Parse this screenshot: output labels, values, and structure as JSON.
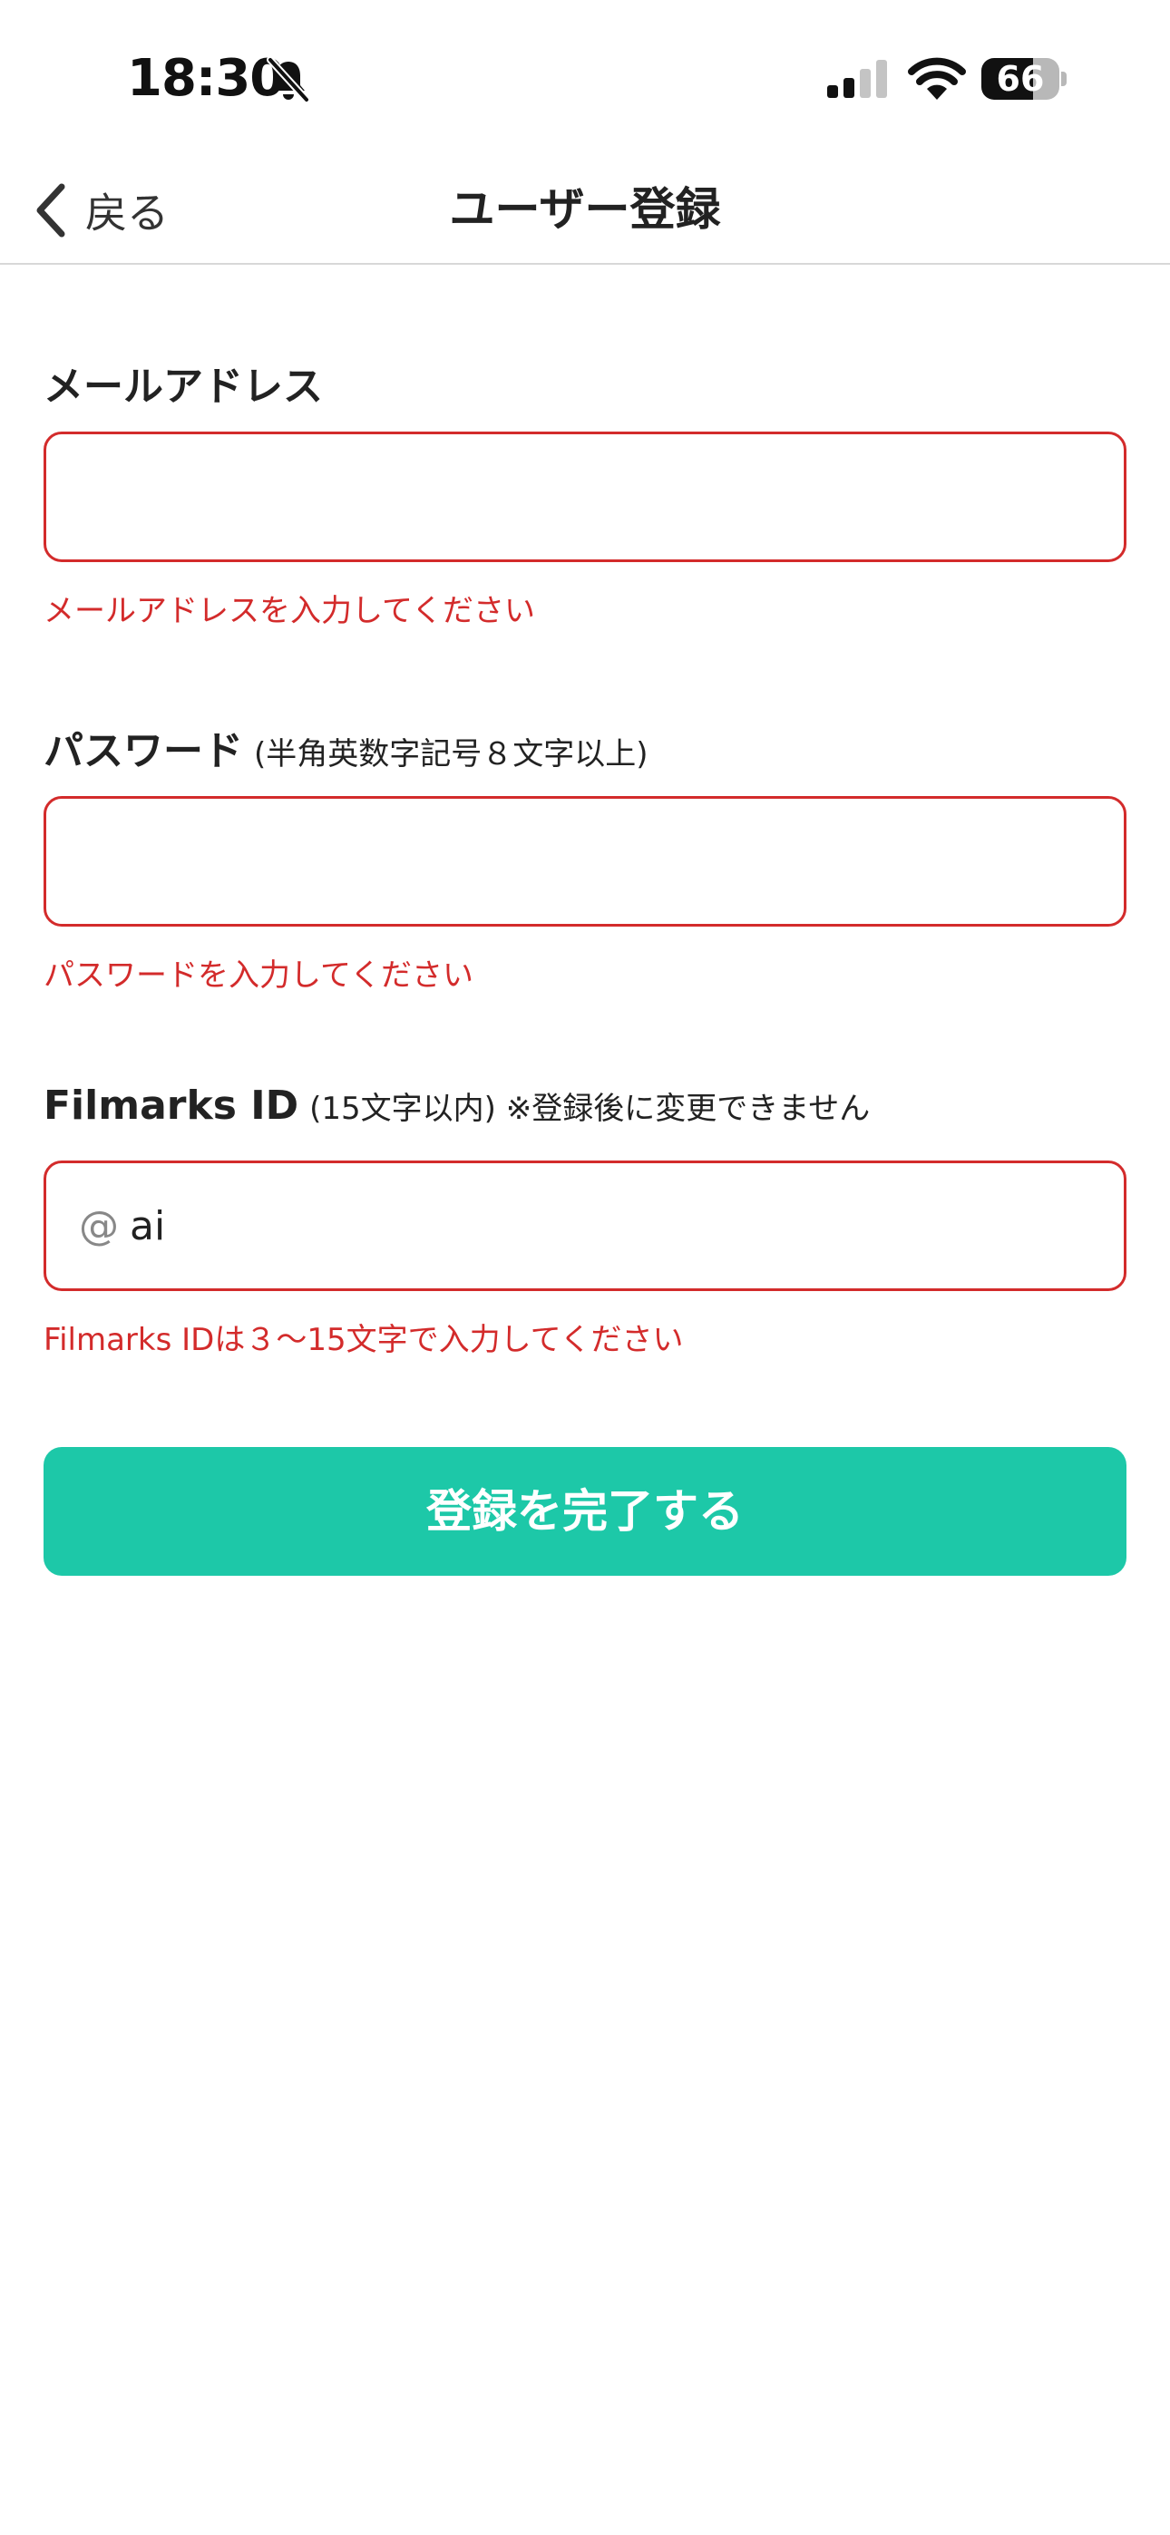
{
  "status_bar": {
    "time": "18:30",
    "battery": "66",
    "icons": [
      "bell-slash-icon",
      "cellular-signal-icon",
      "wifi-icon",
      "battery-icon"
    ]
  },
  "nav": {
    "back_label": "戻る",
    "title": "ユーザー登録"
  },
  "form": {
    "email": {
      "label": "メールアドレス",
      "value": "",
      "error": "メールアドレスを入力してください"
    },
    "password": {
      "label": "パスワード",
      "hint": "(半角英数字記号８文字以上)",
      "value": "",
      "error": "パスワードを入力してください"
    },
    "filmarks_id": {
      "label": "Filmarks ID",
      "hint": "(15文字以内) ※登録後に変更できません",
      "prefix": "@",
      "value": "ai",
      "error": "Filmarks IDは３〜15文字で入力してください"
    },
    "submit_label": "登録を完了する"
  },
  "colors": {
    "accent": "#1dc8a8",
    "error": "#d32b2b"
  }
}
